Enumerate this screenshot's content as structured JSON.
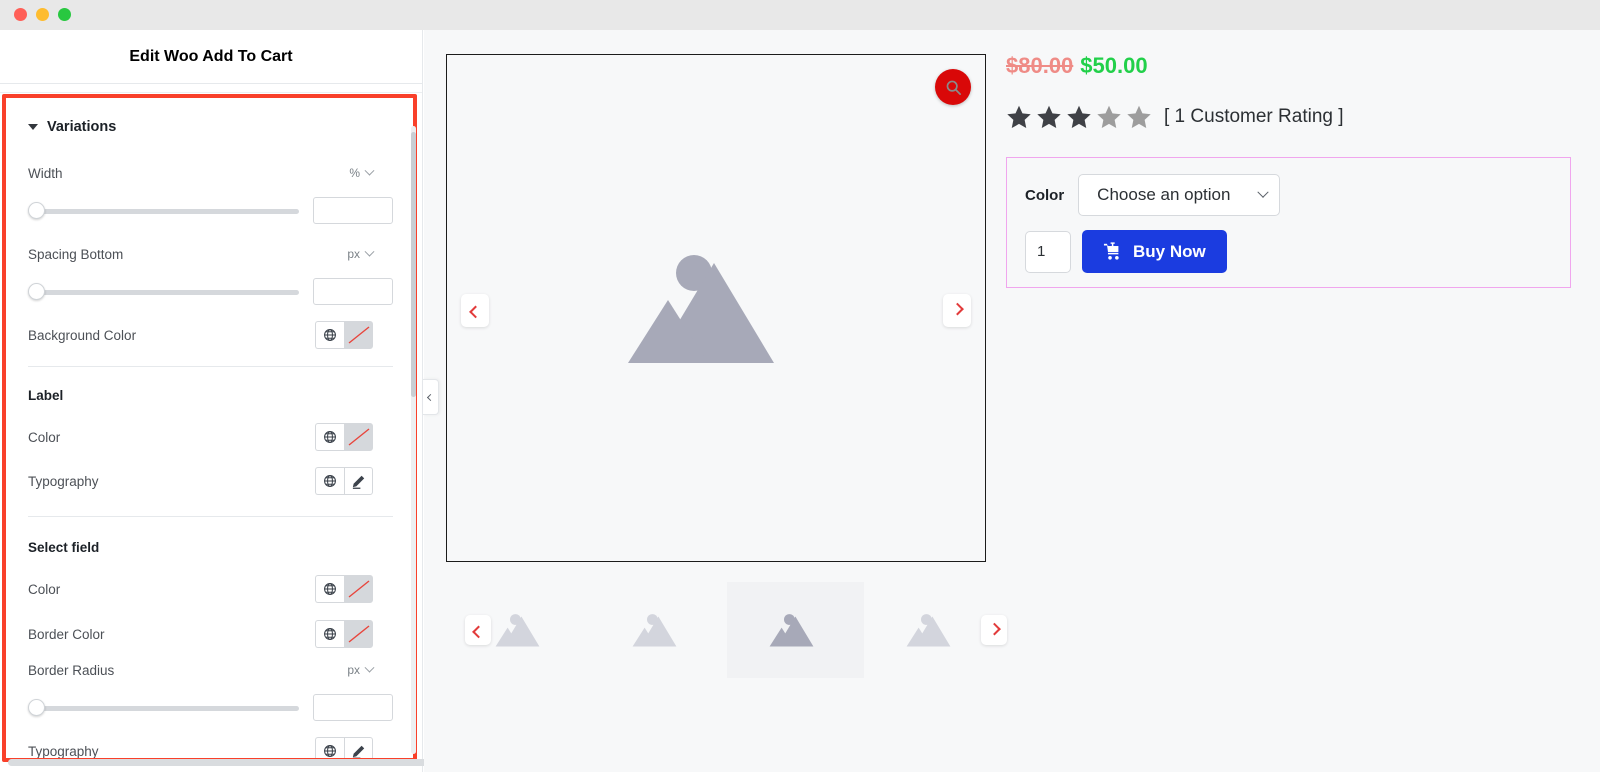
{
  "window": {
    "traffic_lights": [
      "close",
      "minimize",
      "maximize"
    ]
  },
  "editor": {
    "title": "Edit Woo Add To Cart",
    "section": {
      "label": "Variations",
      "toggle_icon": "caret-down-icon"
    },
    "controls": [
      {
        "label": "Width",
        "type": "slider",
        "unit": "%",
        "value": ""
      },
      {
        "label": "Spacing Bottom",
        "type": "slider",
        "unit": "px",
        "value": ""
      },
      {
        "label": "Background Color",
        "type": "color",
        "icons": [
          "globe-icon",
          "no-color-swatch"
        ]
      }
    ],
    "groups": [
      {
        "heading": "Label",
        "controls": [
          {
            "label": "Color",
            "type": "color",
            "icons": [
              "globe-icon",
              "no-color-swatch"
            ]
          },
          {
            "label": "Typography",
            "type": "typography",
            "icons": [
              "globe-icon",
              "pencil-icon"
            ]
          }
        ]
      },
      {
        "heading": "Select field",
        "controls": [
          {
            "label": "Color",
            "type": "color",
            "icons": [
              "globe-icon",
              "no-color-swatch"
            ]
          },
          {
            "label": "Border Color",
            "type": "color",
            "icons": [
              "globe-icon",
              "no-color-swatch"
            ]
          },
          {
            "label": "Border Radius",
            "type": "slider",
            "unit": "px",
            "value": ""
          },
          {
            "label": "Typography",
            "type": "typography",
            "icons": [
              "globe-icon",
              "pencil-icon"
            ]
          }
        ]
      }
    ],
    "highlight_color": "#f9402a"
  },
  "collapse_handle": {
    "icon": "chevron-left-icon"
  },
  "preview": {
    "gallery": {
      "zoom_button_icon": "search-icon",
      "zoom_button_color": "#d90808",
      "prev_icon": "chevron-left-icon",
      "next_icon": "chevron-right-icon",
      "main_image_alt": "image-placeholder",
      "thumbnails": [
        {
          "alt": "image-placeholder",
          "active": false
        },
        {
          "alt": "image-placeholder",
          "active": false
        },
        {
          "alt": "image-placeholder",
          "active": true
        },
        {
          "alt": "image-placeholder",
          "active": false
        }
      ],
      "thumb_prev_icon": "chevron-left-icon",
      "thumb_next_icon": "chevron-right-icon"
    },
    "product": {
      "price_old": "$80.00",
      "price_new": "$50.00",
      "price_old_color": "#ef8b86",
      "price_new_color": "#22d04a",
      "rating": {
        "filled": 3,
        "total": 5,
        "text": "[ 1 Customer Rating ]"
      },
      "variations": {
        "border_color": "#f0a6ee",
        "attribute_label": "Color",
        "select_value": "Choose an option",
        "select_chevron": "chevron-down-icon",
        "quantity": "1",
        "buy_button": {
          "label": "Buy Now",
          "icon": "cart-icon",
          "color": "#1b3ce0"
        }
      }
    }
  }
}
